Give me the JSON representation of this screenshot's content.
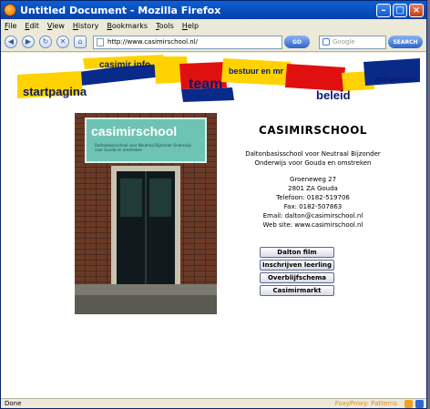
{
  "window": {
    "title": "Untitled Document - Mozilla Firefox"
  },
  "menu": [
    "File",
    "Edit",
    "View",
    "History",
    "Bookmarks",
    "Tools",
    "Help"
  ],
  "nav": {
    "url": "http://www.casimirschool.nl/",
    "go_label": "GO",
    "search_placeholder": "Google",
    "search_label": "SEARCH"
  },
  "banner": {
    "items": {
      "casimir_info": "casimir info",
      "bestuur": "bestuur en mr",
      "startpagina": "startpagina",
      "team": "team",
      "beleid": "beleid",
      "activiteiten": "activiteiten"
    },
    "colors": {
      "navy": "#0a2a8a",
      "yellow": "#ffd200",
      "red": "#e01010"
    }
  },
  "photo": {
    "sign_text": "casimirschool",
    "sign_subtitle": "Daltonbasisschool voor Neutraal Bijzonder Onderwijs voor Gouda en omstreken"
  },
  "info": {
    "school_name": "CASIMIRSCHOOL",
    "line1": "Daltonbasisschool voor Neutraal Bijzonder",
    "line2": "Onderwijs voor Gouda en omstreken",
    "street": "Groeneweg 27",
    "postal": "2801 ZA Gouda",
    "phone": "Telefoon: 0182-519706",
    "fax": "Fax: 0182-507863",
    "email": "Email: dalton@casimirschool.nl",
    "website": "Web site: www.casimirschool.nl"
  },
  "buttons": [
    "Dalton film",
    "Inschrijven leerling",
    "Overblijfschema",
    "Casimirmarkt"
  ],
  "status": {
    "text": "Done",
    "foxy": "FoxyProxy: Patterns"
  }
}
